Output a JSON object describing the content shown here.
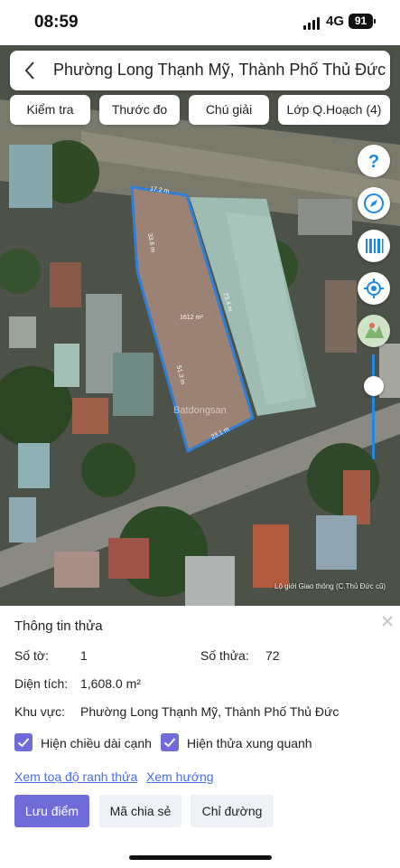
{
  "status_bar": {
    "time": "08:59",
    "network": "4G",
    "battery": "91"
  },
  "header": {
    "title": "Phường Long Thạnh Mỹ, Thành Phố Thủ Đức"
  },
  "toolbar": [
    {
      "label": "Kiểm tra"
    },
    {
      "label": "Thước đo"
    },
    {
      "label": "Chú giải"
    },
    {
      "label": "Lớp Q.Hoạch (4)"
    }
  ],
  "map": {
    "edge_top": "17.2 m",
    "edge_left": "33.6 m",
    "edge_right": "73.4 m",
    "edge_inner": "51.3 m",
    "edge_bottom": "23.1 m",
    "area_label": "1612 m²",
    "watermark": "Batdongsan",
    "attribution": "Lộ giới Giao thông (C.Thủ Đức cũ)",
    "outline_color": "#2f7fd9",
    "side_controls": [
      "help-icon",
      "compass-icon",
      "barcode-icon",
      "locate-icon",
      "basemap-icon"
    ]
  },
  "parcel_info": {
    "title": "Thông tin thửa",
    "so_to_label": "Số tờ:",
    "so_to_value": "1",
    "so_thua_label": "Số thửa:",
    "so_thua_value": "72",
    "dien_tich_label": "Diện tích:",
    "dien_tich_value": "1,608.0 m²",
    "khu_vuc_label": "Khu vực:",
    "khu_vuc_value": "Phường Long Thạnh Mỹ, Thành Phố Thủ Đức",
    "option_edges": "Hiện chiều dài cạnh",
    "option_neighbors": "Hiện thửa xung quanh",
    "link_coords": "Xem toạ độ ranh thửa",
    "link_direction": "Xem hướng",
    "btn_save": "Lưu điểm",
    "btn_share": "Mã chia sẻ",
    "btn_route": "Chỉ đường",
    "accent_color": "#6f6bd9"
  }
}
